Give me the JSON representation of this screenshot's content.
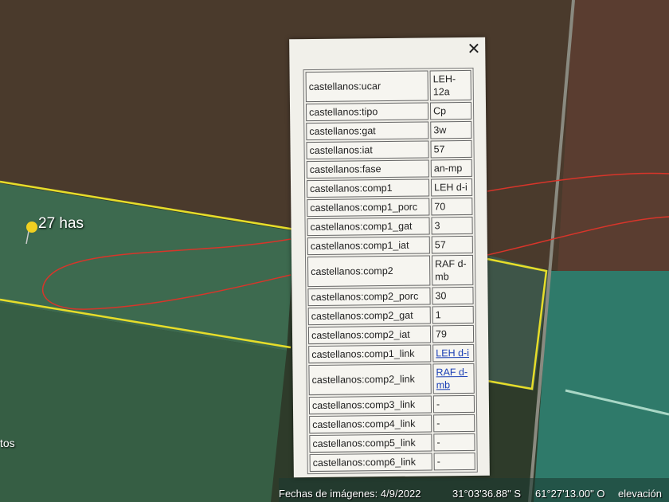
{
  "map": {
    "placemark_label": "27 has",
    "left_edge_label": "tos"
  },
  "popup": {
    "close_icon": "close-icon",
    "rows": [
      {
        "key": "castellanos:ucar",
        "value": "LEH-12a"
      },
      {
        "key": "castellanos:tipo",
        "value": "Cp"
      },
      {
        "key": "castellanos:gat",
        "value": "3w"
      },
      {
        "key": "castellanos:iat",
        "value": "57"
      },
      {
        "key": "castellanos:fase",
        "value": "an-mp"
      },
      {
        "key": "castellanos:comp1",
        "value": "LEH d-i"
      },
      {
        "key": "castellanos:comp1_porc",
        "value": "70"
      },
      {
        "key": "castellanos:comp1_gat",
        "value": "3"
      },
      {
        "key": "castellanos:comp1_iat",
        "value": "57"
      },
      {
        "key": "castellanos:comp2",
        "value": "RAF d-mb"
      },
      {
        "key": "castellanos:comp2_porc",
        "value": "30"
      },
      {
        "key": "castellanos:comp2_gat",
        "value": "1"
      },
      {
        "key": "castellanos:comp2_iat",
        "value": "79"
      },
      {
        "key": "castellanos:comp1_link",
        "value": "LEH d-i",
        "link": true
      },
      {
        "key": "castellanos:comp2_link",
        "value": "RAF d-mb",
        "link": true
      },
      {
        "key": "castellanos:comp3_link",
        "value": "-"
      },
      {
        "key": "castellanos:comp4_link",
        "value": "-"
      },
      {
        "key": "castellanos:comp5_link",
        "value": "-"
      },
      {
        "key": "castellanos:comp6_link",
        "value": "-"
      }
    ]
  },
  "status_bar": {
    "image_date": "Fechas de imágenes: 4/9/2022",
    "latitude": "31°03'36.88\" S",
    "longitude": "61°27'13.00\" O",
    "elevation_label": "elevación"
  }
}
